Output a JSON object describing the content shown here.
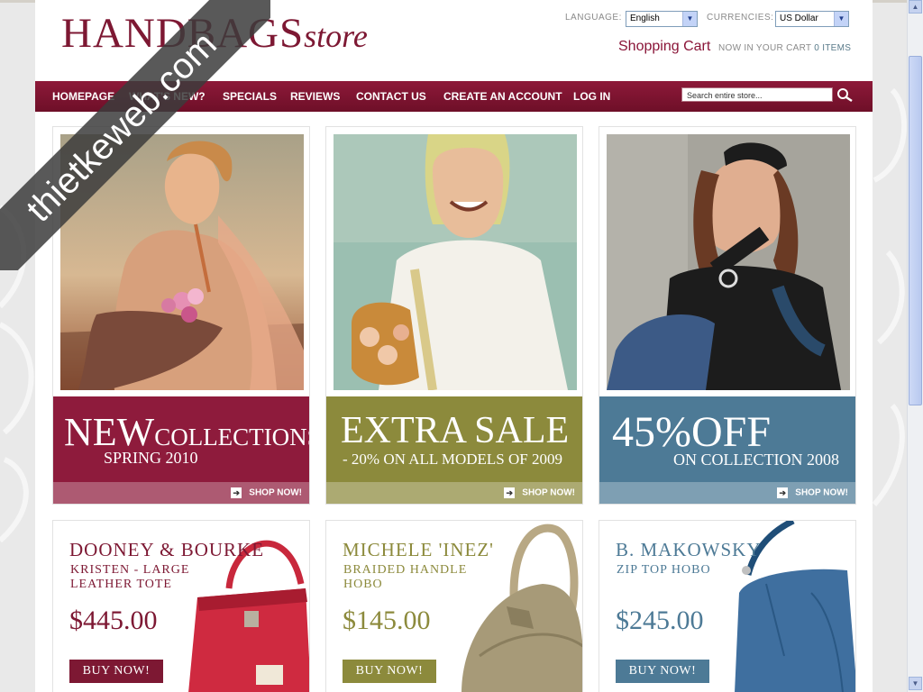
{
  "brand": {
    "logo_main": "HANDBAGS",
    "logo_script": "store"
  },
  "header": {
    "language_label": "LANGUAGE:",
    "language_value": "English",
    "currency_label": "CURRENCIES:",
    "currency_value": "US Dollar",
    "cart_title": "Shopping Cart",
    "cart_status": "NOW IN YOUR CART",
    "cart_count": "0 ITEMS"
  },
  "nav": {
    "items": [
      "HOMEPAGE",
      "WHAT'S NEW?",
      "SPECIALS",
      "REVIEWS",
      "CONTACT US",
      "CREATE AN ACCOUNT",
      "LOG IN"
    ],
    "search_placeholder": "Search entire store..."
  },
  "promos": [
    {
      "big": "NEW",
      "rest": "COLLECTIONS",
      "sub": "SPRING 2010",
      "shop": "SHOP NOW!"
    },
    {
      "big": "EXTRA SALE",
      "sub": "- 20% ON ALL MODELS OF 2009",
      "shop": "SHOP NOW!"
    },
    {
      "big": "45%OFF",
      "sub": "ON COLLECTION 2008",
      "shop": "SHOP NOW!"
    }
  ],
  "products": [
    {
      "brand": "DOONEY & BOURKE",
      "line1": "KRISTEN - LARGE",
      "line2": "LEATHER TOTE",
      "price": "$445.00",
      "buy": "BUY NOW!"
    },
    {
      "brand": "MICHELE 'INEZ'",
      "line1": "BRAIDED HANDLE",
      "line2": "HOBO",
      "price": "$145.00",
      "buy": "BUY NOW!"
    },
    {
      "brand": "B. MAKOWSKY",
      "line1": "ZIP TOP HOBO",
      "line2": "",
      "price": "$245.00",
      "buy": "BUY NOW!"
    }
  ],
  "watermark": "thietkeweb.com",
  "colors": {
    "burgundy": "#7d1833",
    "olive": "#8c8a3c",
    "steel": "#4d7a96",
    "nav": "#7a1230"
  }
}
